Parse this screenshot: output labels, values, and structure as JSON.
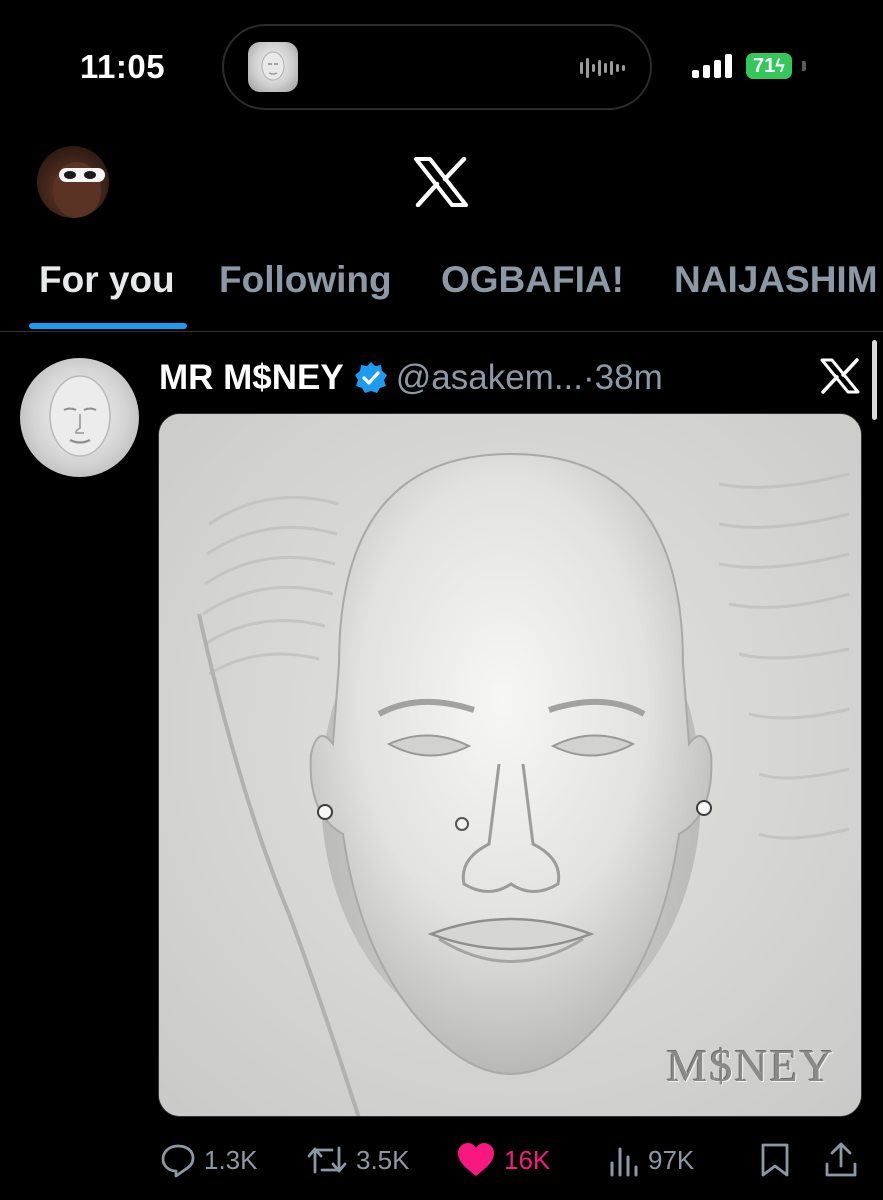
{
  "status_bar": {
    "time": "11:05",
    "battery": "71",
    "icons": [
      "signal-icon",
      "battery-charging-icon",
      "audio-waveform-icon"
    ]
  },
  "header": {
    "logo": "x-logo-icon",
    "my_avatar": "user-avatar"
  },
  "tabs": [
    {
      "label": "For you",
      "active": true
    },
    {
      "label": "Following",
      "active": false
    },
    {
      "label": "OGBAFIA!",
      "active": false
    },
    {
      "label": "NAIJASHIM",
      "active": false
    }
  ],
  "tweet": {
    "display_name": "MR M$NEY",
    "handle": "@asakem...",
    "separator": "·",
    "time_ago": "38m",
    "verified": true,
    "media_caption": "M$NEY",
    "actions": {
      "replies": "1.3K",
      "reposts": "3.5K",
      "likes": "16K",
      "views": "97K"
    }
  },
  "colors": {
    "background": "#000000",
    "accent": "#1d9bf0",
    "like": "#f91880",
    "muted": "#8b98a5",
    "battery": "#34c759"
  }
}
